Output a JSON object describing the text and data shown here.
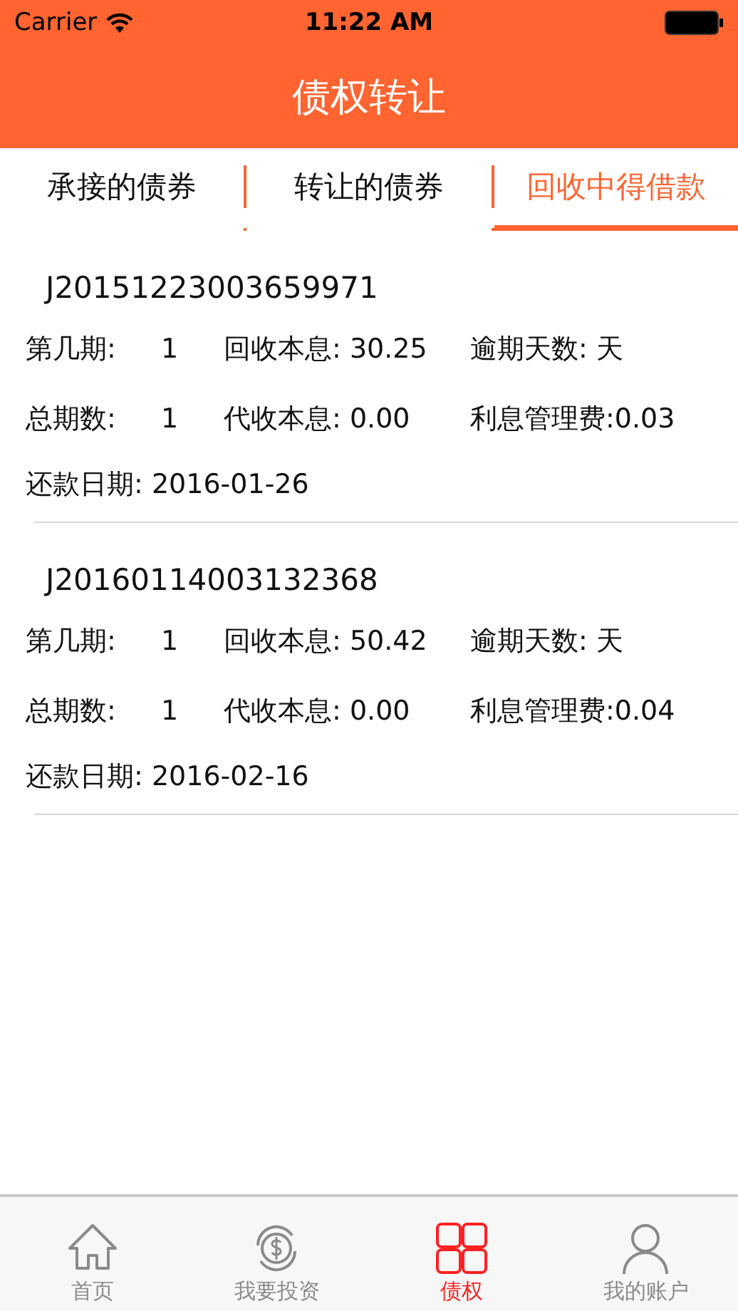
{
  "status_bar": {
    "carrier": "Carrier",
    "time": "11:22 AM"
  },
  "header": {
    "title": "债权转让"
  },
  "tabs": [
    {
      "label": "承接的债券",
      "selected": false
    },
    {
      "label": "转让的债券",
      "selected": false
    },
    {
      "label": "回收中得借款",
      "selected": true
    }
  ],
  "records": [
    {
      "id": "J20151223003659971",
      "period_label": "第几期:",
      "period": "1",
      "recovered": "回收本息: 30.25",
      "overdue": "逾期天数: 天",
      "total_label": "总期数:",
      "total": "1",
      "pending": "代收本息: 0.00",
      "fee": "利息管理费:0.03",
      "due_date": "还款日期: 2016-01-26"
    },
    {
      "id": "J20160114003132368",
      "period_label": "第几期:",
      "period": "1",
      "recovered": "回收本息: 50.42",
      "overdue": "逾期天数: 天",
      "total_label": "总期数:",
      "total": "1",
      "pending": "代收本息: 0.00",
      "fee": "利息管理费:0.04",
      "due_date": "还款日期: 2016-02-16"
    }
  ],
  "tab_bar": [
    {
      "kind": "home",
      "label": "首页",
      "selected": false
    },
    {
      "kind": "invest",
      "label": "我要投资",
      "selected": false
    },
    {
      "kind": "grid",
      "label": "债权",
      "selected": true
    },
    {
      "kind": "account",
      "label": "我的账户",
      "selected": false
    }
  ]
}
